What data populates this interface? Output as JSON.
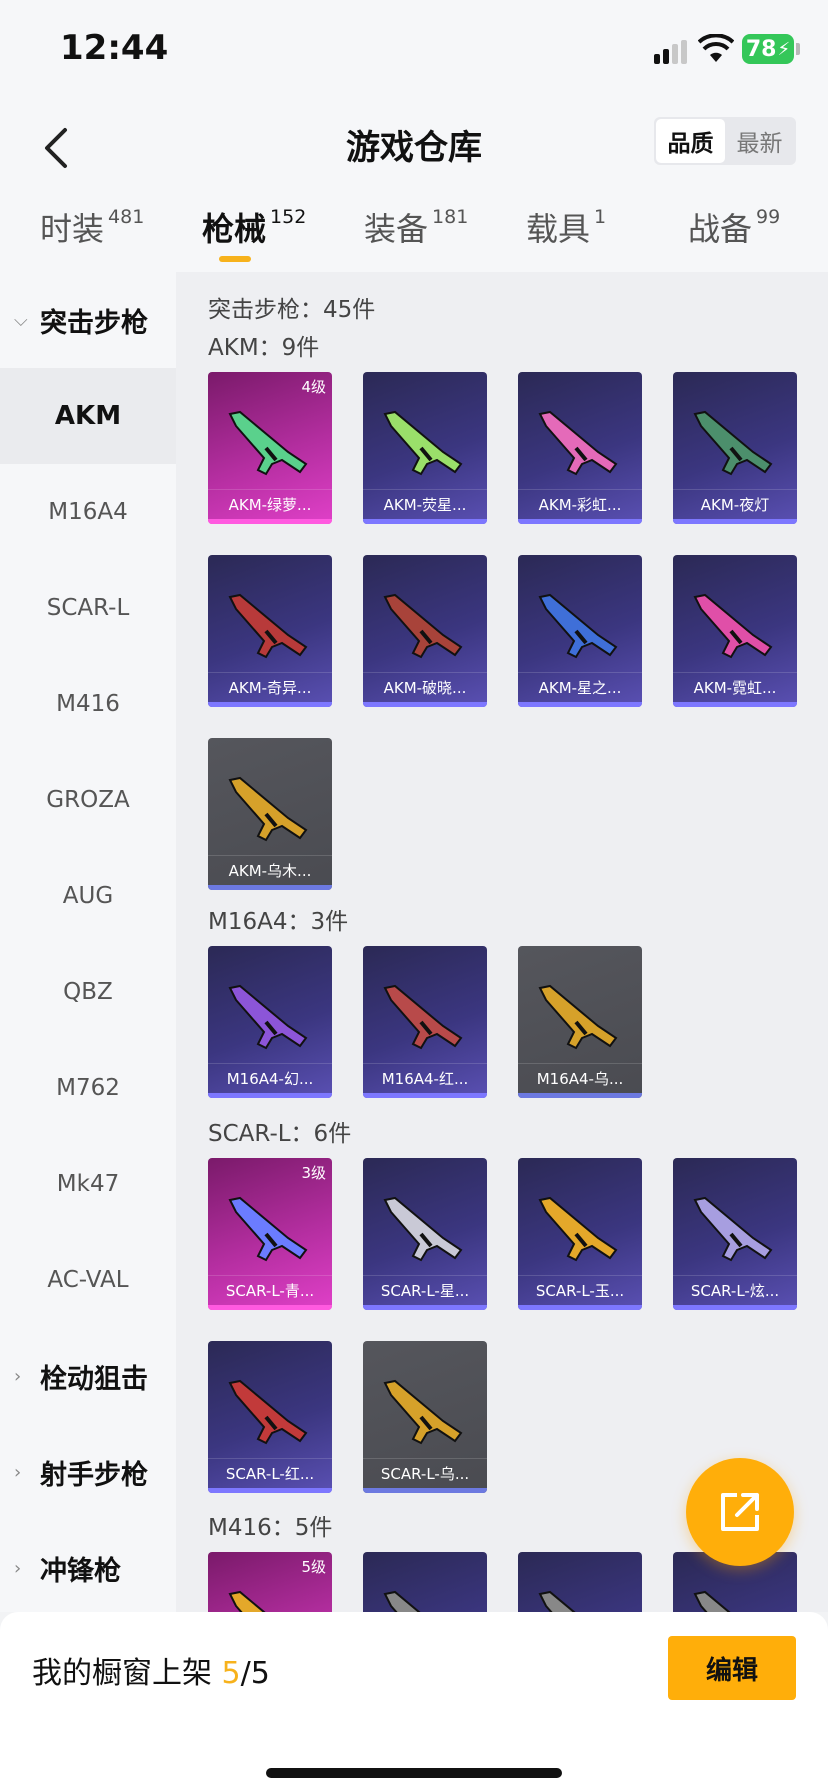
{
  "status": {
    "time": "12:44",
    "battery": "78"
  },
  "header": {
    "title": "游戏仓库",
    "sort": [
      "品质",
      "最新"
    ]
  },
  "tabs": [
    {
      "label": "时装",
      "count": "481"
    },
    {
      "label": "枪械",
      "count": "152"
    },
    {
      "label": "装备",
      "count": "181"
    },
    {
      "label": "载具",
      "count": "1"
    },
    {
      "label": "战备",
      "count": "99"
    }
  ],
  "sidebar": {
    "category_open": "突击步枪",
    "items": [
      "AKM",
      "M16A4",
      "SCAR-L",
      "M416",
      "GROZA",
      "AUG",
      "QBZ",
      "M762",
      "Mk47",
      "AC-VAL"
    ],
    "categories_closed": [
      "栓动狙击",
      "射手步枪",
      "冲锋枪"
    ]
  },
  "content": {
    "category_title": "突击步枪：45件",
    "groups": [
      {
        "title": "AKM：9件",
        "cards": [
          {
            "name": "AKM-绿萝...",
            "level": "4级",
            "style": "pink",
            "gun": "#5ad18c"
          },
          {
            "name": "AKM-荧星...",
            "style": "purple",
            "gun": "#9adf6a"
          },
          {
            "name": "AKM-彩虹...",
            "style": "purple",
            "gun": "#e46ab9"
          },
          {
            "name": "AKM-夜灯",
            "style": "purple",
            "gun": "#4c8f6c"
          },
          {
            "name": "AKM-奇异...",
            "style": "purple",
            "gun": "#b83a3a"
          },
          {
            "name": "AKM-破晓...",
            "style": "purple",
            "gun": "#a8433a"
          },
          {
            "name": "AKM-星之...",
            "style": "purple",
            "gun": "#3f6fd8"
          },
          {
            "name": "AKM-霓虹...",
            "style": "purple",
            "gun": "#e04fa8"
          },
          {
            "name": "AKM-乌木...",
            "style": "gray",
            "gun": "#d6a12a"
          }
        ]
      },
      {
        "title": "M16A4：3件",
        "cards": [
          {
            "name": "M16A4-幻...",
            "style": "purple",
            "gun": "#8c55d8"
          },
          {
            "name": "M16A4-红...",
            "style": "purple",
            "gun": "#b84a4a"
          },
          {
            "name": "M16A4-乌...",
            "style": "gray",
            "gun": "#d6a12a"
          }
        ]
      },
      {
        "title": "SCAR-L：6件",
        "cards": [
          {
            "name": "SCAR-L-青...",
            "level": "3级",
            "style": "pink",
            "gun": "#6b7cff"
          },
          {
            "name": "SCAR-L-星...",
            "style": "purple",
            "gun": "#c9c9d6"
          },
          {
            "name": "SCAR-L-玉...",
            "style": "purple",
            "gun": "#e4a82a"
          },
          {
            "name": "SCAR-L-炫...",
            "style": "purple",
            "gun": "#a79ee0"
          },
          {
            "name": "SCAR-L-红...",
            "style": "purple",
            "gun": "#c23a3a"
          },
          {
            "name": "SCAR-L-乌...",
            "style": "gray",
            "gun": "#d6a12a"
          }
        ]
      },
      {
        "title": "M416：5件",
        "cards": [
          {
            "name": "",
            "level": "5级",
            "style": "pink",
            "gun": "#e4a82a"
          },
          {
            "name": "",
            "style": "purple",
            "gun": "#888"
          },
          {
            "name": "",
            "style": "purple",
            "gun": "#888"
          },
          {
            "name": "",
            "style": "purple",
            "gun": "#888"
          }
        ]
      }
    ]
  },
  "bottom": {
    "shelf_label": "我的橱窗上架",
    "shelf_used": "5",
    "shelf_total": "/5",
    "edit_label": "编辑"
  }
}
